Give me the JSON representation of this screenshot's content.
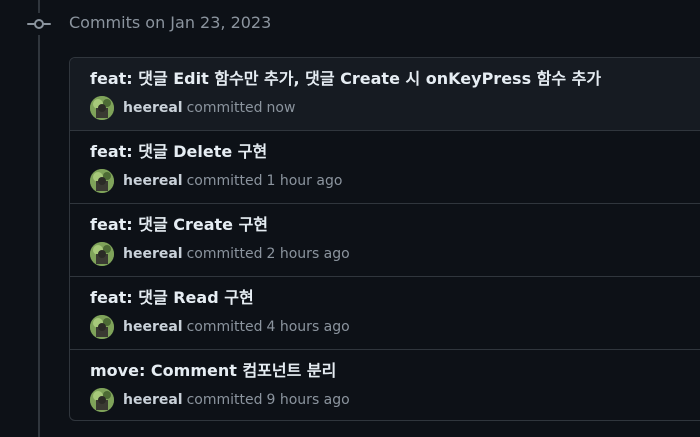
{
  "group": {
    "heading": "Commits on Jan 23, 2023",
    "icon": "git-commit-icon"
  },
  "colors": {
    "background": "#0d1117",
    "border": "#30363d",
    "row_highlight": "#161b22",
    "title_text": "#e6edf3",
    "muted_text": "#8b949e"
  },
  "commits": [
    {
      "message": "feat: 댓글 Edit 함수만 추가, 댓글 Create 시 onKeyPress 함수 추가",
      "author": "heereal",
      "action": "committed",
      "time": "now"
    },
    {
      "message": "feat: 댓글 Delete 구현",
      "author": "heereal",
      "action": "committed",
      "time": "1 hour ago"
    },
    {
      "message": "feat: 댓글 Create 구현",
      "author": "heereal",
      "action": "committed",
      "time": "2 hours ago"
    },
    {
      "message": "feat: 댓글 Read 구현",
      "author": "heereal",
      "action": "committed",
      "time": "4 hours ago"
    },
    {
      "message": "move: Comment 컴포넌트 분리",
      "author": "heereal",
      "action": "committed",
      "time": "9 hours ago"
    }
  ]
}
